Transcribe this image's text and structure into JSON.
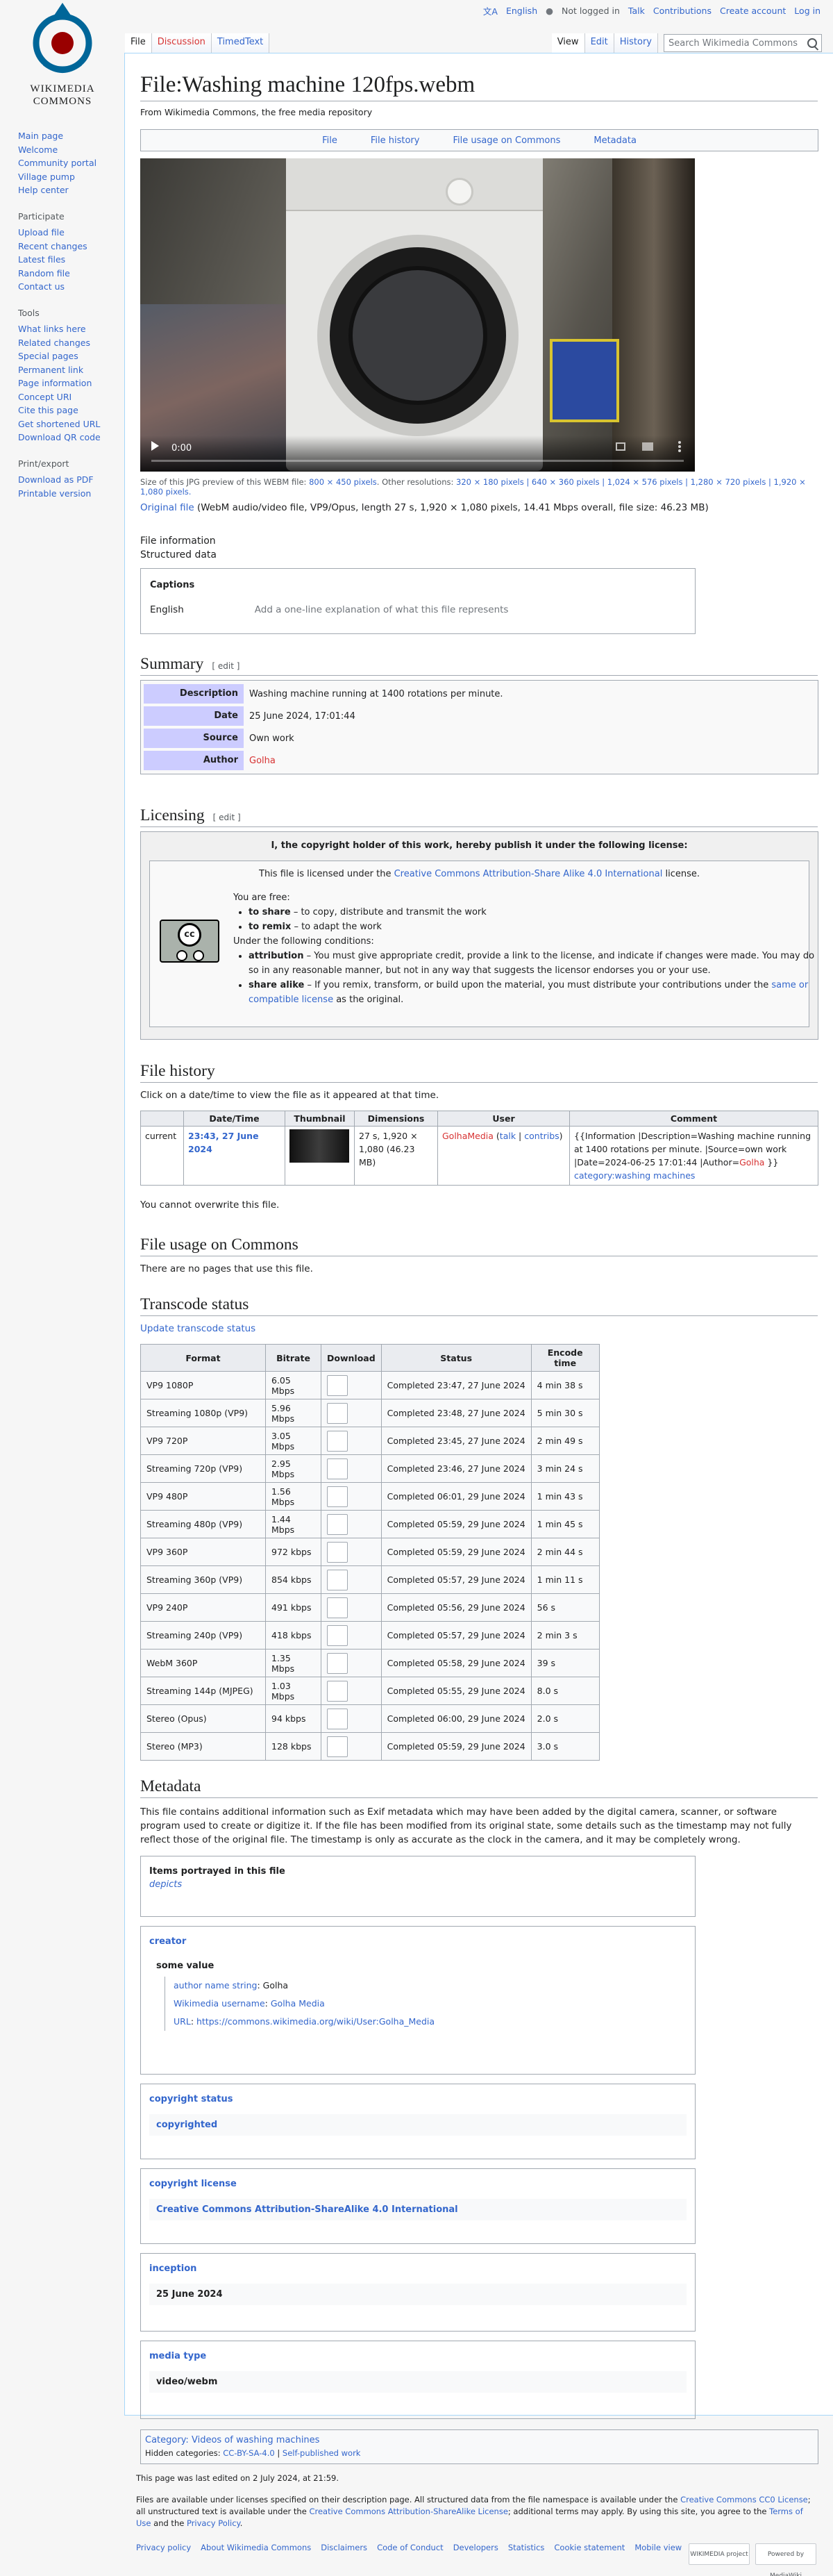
{
  "site": {
    "logo_line1": "WIKIMEDIA",
    "logo_line2": "COMMONS"
  },
  "personal_tools": {
    "language": "English",
    "not_logged_in": "Not logged in",
    "talk": "Talk",
    "contributions": "Contributions",
    "create_account": "Create account",
    "login": "Log in"
  },
  "tabs_left": [
    "File",
    "Discussion",
    "TimedText"
  ],
  "tabs_right": [
    "View",
    "Edit",
    "History"
  ],
  "search": {
    "placeholder": "Search Wikimedia Commons"
  },
  "sidebar": {
    "nav": [
      "Main page",
      "Welcome",
      "Community portal",
      "Village pump",
      "Help center"
    ],
    "participate_title": "Participate",
    "participate": [
      "Upload file",
      "Recent changes",
      "Latest files",
      "Random file",
      "Contact us"
    ],
    "tools_title": "Tools",
    "tools": [
      "What links here",
      "Related changes",
      "Special pages",
      "Permanent link",
      "Page information",
      "Concept URI",
      "Cite this page",
      "Get shortened URL",
      "Download QR code"
    ],
    "print_title": "Print/export",
    "print": [
      "Download as PDF",
      "Printable version"
    ]
  },
  "page": {
    "title": "File:Washing machine 120fps.webm",
    "tagline": "From Wikimedia Commons, the free media repository"
  },
  "filetoc": [
    "File",
    "File history",
    "File usage on Commons",
    "Metadata"
  ],
  "video": {
    "time": "0:00"
  },
  "sizeinfo": {
    "prefix": "Size of this JPG preview of this WEBM file:",
    "current": "800 × 450 pixels",
    "others_label": ". Other resolutions:",
    "others": "320 × 180 pixels | 640 × 360 pixels | 1,024 × 576 pixels | 1,280 × 720 pixels | 1,920 × 1,080 pixels."
  },
  "origfile": {
    "link": "Original file",
    "desc": "(WebM audio/video file, VP9/Opus, length 27 s, 1,920 × 1,080 pixels, 14.41 Mbps overall, file size: 46.23 MB)"
  },
  "fileinfo": {
    "l1": "File information",
    "l2": "Structured data"
  },
  "captions": {
    "title": "Captions",
    "lang": "English",
    "placeholder": "Add a one-line explanation of what this file represents"
  },
  "summary": {
    "heading": "Summary",
    "edit": "[ edit ]",
    "rows": [
      {
        "k": "Description",
        "v": "Washing machine running at 1400 rotations per minute."
      },
      {
        "k": "Date",
        "v": "25 June 2024, 17:01:44"
      },
      {
        "k": "Source",
        "v": "Own work"
      },
      {
        "k": "Author",
        "v": "Golha"
      }
    ]
  },
  "licensing": {
    "heading": "Licensing",
    "edit": "[ edit ]",
    "header": "I, the copyright holder of this work, hereby publish it under the following license:",
    "lic_pre": "This file is licensed under the",
    "lic_link": "Creative Commons Attribution-Share Alike 4.0 International",
    "lic_post": "license.",
    "free": "You are free:",
    "share_b": "to share",
    "share_t": "– to copy, distribute and transmit the work",
    "remix_b": "to remix",
    "remix_t": "– to adapt the work",
    "cond": "Under the following conditions:",
    "attr_b": "attribution",
    "attr_t": "– You must give appropriate credit, provide a link to the license, and indicate if changes were made. You may do so in any reasonable manner, but not in any way that suggests the licensor endorses you or your use.",
    "sa_b": "share alike",
    "sa_t": "– If you remix, transform, or build upon the material, you must distribute your contributions under the",
    "sa_link": "same or compatible license",
    "sa_post": "as the original.",
    "cc_badge": "cc",
    "cc_sub": "SOME RIGHTS RESERVED"
  },
  "history": {
    "heading": "File history",
    "intro": "Click on a date/time to view the file as it appeared at that time.",
    "cols": [
      "",
      "Date/Time",
      "Thumbnail",
      "Dimensions",
      "User",
      "Comment"
    ],
    "row": {
      "current": "current",
      "date": "23:43, 27 June 2024",
      "dims": "27 s, 1,920 × 1,080 (46.23 MB)",
      "user": "GolhaMedia",
      "talk": "talk",
      "contribs": "contribs",
      "comment": "{{Information |Description=Washing machine running at 1400 rotations per minute. |Source=own work |Date=2024-06-25 17:01:44 |Author=",
      "comment_author": "Golha",
      "comment_end": " }}",
      "category": "category:washing machines"
    },
    "nooverwrite": "You cannot overwrite this file."
  },
  "usage": {
    "heading": "File usage on Commons",
    "text": "There are no pages that use this file."
  },
  "transcode": {
    "heading": "Transcode status",
    "update": "Update transcode status",
    "cols": [
      "Format",
      "Bitrate",
      "Download",
      "Status",
      "Encode time"
    ],
    "rows": [
      [
        "VP9 1080P",
        "6.05 Mbps",
        "Completed 23:47, 27 June 2024",
        "4 min 38 s"
      ],
      [
        "Streaming 1080p (VP9)",
        "5.96 Mbps",
        "Completed 23:48, 27 June 2024",
        "5 min 30 s"
      ],
      [
        "VP9 720P",
        "3.05 Mbps",
        "Completed 23:45, 27 June 2024",
        "2 min 49 s"
      ],
      [
        "Streaming 720p (VP9)",
        "2.95 Mbps",
        "Completed 23:46, 27 June 2024",
        "3 min 24 s"
      ],
      [
        "VP9 480P",
        "1.56 Mbps",
        "Completed 06:01, 29 June 2024",
        "1 min 43 s"
      ],
      [
        "Streaming 480p (VP9)",
        "1.44 Mbps",
        "Completed 05:59, 29 June 2024",
        "1 min 45 s"
      ],
      [
        "VP9 360P",
        "972 kbps",
        "Completed 05:59, 29 June 2024",
        "2 min 44 s"
      ],
      [
        "Streaming 360p (VP9)",
        "854 kbps",
        "Completed 05:57, 29 June 2024",
        "1 min 11 s"
      ],
      [
        "VP9 240P",
        "491 kbps",
        "Completed 05:56, 29 June 2024",
        "56 s"
      ],
      [
        "Streaming 240p (VP9)",
        "418 kbps",
        "Completed 05:57, 29 June 2024",
        "2 min 3 s"
      ],
      [
        "WebM 360P",
        "1.35 Mbps",
        "Completed 05:58, 29 June 2024",
        "39 s"
      ],
      [
        "Streaming 144p (MJPEG)",
        "1.03 Mbps",
        "Completed 05:55, 29 June 2024",
        "8.0 s"
      ],
      [
        "Stereo (Opus)",
        "94 kbps",
        "Completed 06:00, 29 June 2024",
        "2.0 s"
      ],
      [
        "Stereo (MP3)",
        "128 kbps",
        "Completed 05:59, 29 June 2024",
        "3.0 s"
      ]
    ]
  },
  "metadata": {
    "heading": "Metadata",
    "intro": "This file contains additional information such as Exif metadata which may have been added by the digital camera, scanner, or software program used to create or digitize it. If the file has been modified from its original state, some details such as the timestamp may not fully reflect those of the original file. The timestamp is only as accurate as the clock in the camera, and it may be completely wrong.",
    "portrayed_title": "Items portrayed in this file",
    "portrayed_val": "depicts",
    "creator_title": "creator",
    "creator_sub": "some value",
    "creator_q1_k": "author name string",
    "creator_q1_v": "Golha",
    "creator_q2_k": "Wikimedia username",
    "creator_q2_v": "Golha Media",
    "creator_q3_k": "URL",
    "creator_q3_v": "https://commons.wikimedia.org/wiki/User:Golha_Media",
    "copyright_title": "copyright status",
    "copyright_val": "copyrighted",
    "license_title": "copyright license",
    "license_val": "Creative Commons Attribution-ShareAlike 4.0 International",
    "inception_title": "inception",
    "inception_val": "25 June 2024",
    "media_title": "media type",
    "media_val": "video/webm"
  },
  "categories": {
    "cat_label": "Category:",
    "cat": "Videos of washing machines",
    "hidden_label": "Hidden categories:",
    "hidden1": "CC-BY-SA-4.0",
    "hidden2": "Self-published work"
  },
  "footer": {
    "edited": "This page was last edited on 2 July 2024, at 21:59.",
    "lic1": "Files are available under licenses specified on their description page. All structured data from the file namespace is available under the",
    "lic_cc0": "Creative Commons CC0 License",
    "lic2": "; all unstructured text is available under the",
    "lic_bysa": "Creative Commons Attribution-ShareAlike License",
    "lic3": "; additional terms may apply. By using this site, you agree to the",
    "tou": "Terms of Use",
    "and": "and the",
    "privacy": "Privacy Policy",
    "links": [
      "Privacy policy",
      "About Wikimedia Commons",
      "Disclaimers",
      "Code of Conduct",
      "Developers",
      "Statistics",
      "Cookie statement",
      "Mobile view"
    ],
    "badge1": "WIKIMEDIA project",
    "badge2": "Powered by MediaWiki"
  }
}
